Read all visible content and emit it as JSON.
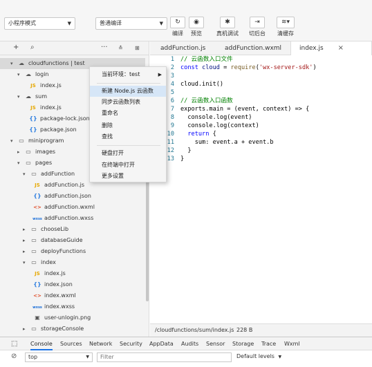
{
  "toolbar": {
    "mode_select": "小程序模式",
    "compile_select": "普通编译",
    "buttons": {
      "compile": "编译",
      "preview": "预览",
      "real_debug": "真机调试",
      "background": "切后台",
      "clear_cache": "清缓存"
    }
  },
  "tree": {
    "root": "cloudfunctions | test",
    "login": "login",
    "login_index": "index.js",
    "sum": "sum",
    "sum_index": "index.js",
    "sum_pkglock": "package-lock.json",
    "sum_pkg": "package.json",
    "miniprogram": "miniprogram",
    "images": "images",
    "pages": "pages",
    "addFunction": "addFunction",
    "af_js": "addFunction.js",
    "af_json": "addFunction.json",
    "af_wxml": "addFunction.wxml",
    "af_wxss": "addFunction.wxss",
    "chooseLib": "chooseLib",
    "databaseGuide": "databaseGuide",
    "deployFunctions": "deployFunctions",
    "index": "index",
    "idx_js": "index.js",
    "idx_json": "index.json",
    "idx_wxml": "index.wxml",
    "idx_wxss": "index.wxss",
    "idx_png": "user-unlogin.png",
    "storageConsole": "storageConsole"
  },
  "context_menu": {
    "env": "当前环境：test",
    "new_node": "新建 Node.js 云函数",
    "sync_list": "同步云函数列表",
    "rename": "重命名",
    "delete": "删除",
    "find": "查找",
    "open_disk": "硬盘打开",
    "open_terminal": "在终端中打开",
    "more": "更多设置"
  },
  "editor": {
    "tabs": [
      "addFunction.js",
      "addFunction.wxml",
      "index.js"
    ],
    "close_glyph": "×",
    "status_path": "/cloudfunctions/sum/index.js",
    "status_size": "228 B",
    "line_numbers": [
      "1",
      "2",
      "3",
      "4",
      "5",
      "6",
      "7",
      "8",
      "9",
      "10",
      "11",
      "12",
      "13"
    ],
    "lines": [
      "// 云函数入口文件",
      "const cloud = require('wx-server-sdk')",
      "",
      "cloud.init()",
      "",
      "// 云函数入口函数",
      "exports.main = (event, context) => {",
      "  console.log(event)",
      "  console.log(context)",
      "  return {",
      "    sum: event.a + event.b",
      "  }",
      "}"
    ]
  },
  "devtools": {
    "tabs": [
      "Console",
      "Sources",
      "Network",
      "Security",
      "AppData",
      "Audits",
      "Sensor",
      "Storage",
      "Trace",
      "Wxml"
    ],
    "context": "top",
    "filter_placeholder": "Filter",
    "levels": "Default levels"
  },
  "colors": {
    "comment": "#008000",
    "keyword": "#0000ff",
    "string": "#a31515",
    "line_number": "#237893",
    "selection": "#d9d9d9",
    "active_tab_underline": "#1a73e8"
  }
}
